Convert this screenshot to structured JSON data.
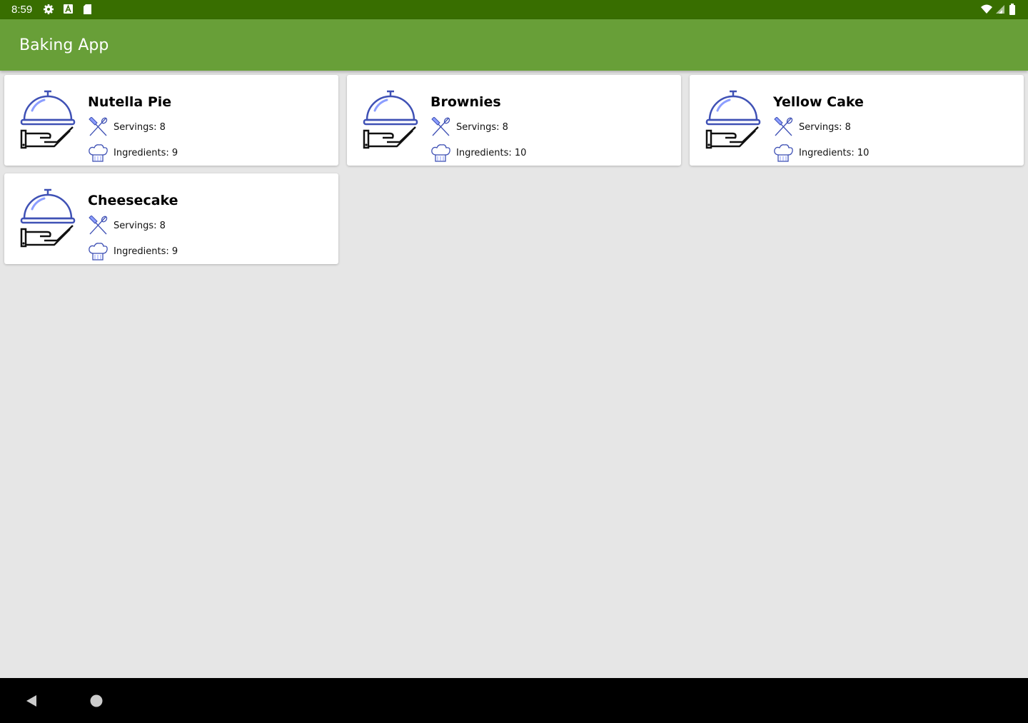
{
  "status_bar": {
    "time": "8:59",
    "left_icons": [
      "gear-icon",
      "a-letter-icon",
      "sd-card-icon"
    ],
    "right_icons": [
      "wifi-icon",
      "signal-icon",
      "battery-icon"
    ],
    "background": "#386e00"
  },
  "app_bar": {
    "title": "Baking App",
    "background": "#689f38"
  },
  "recipes": [
    {
      "name": "Nutella Pie",
      "servings": "Servings: 8",
      "ingredients": "Ingredients: 9"
    },
    {
      "name": "Brownies",
      "servings": "Servings: 8",
      "ingredients": "Ingredients: 10"
    },
    {
      "name": "Yellow Cake",
      "servings": "Servings: 8",
      "ingredients": "Ingredients: 10"
    },
    {
      "name": "Cheesecake",
      "servings": "Servings: 8",
      "ingredients": "Ingredients: 9"
    }
  ],
  "card_icons": {
    "main": "serving-cloche-icon",
    "servings": "fork-spoon-icon",
    "ingredients": "chef-hat-icon"
  },
  "colors": {
    "icon_blue": "#3f51b5",
    "icon_light": "#8c9eff",
    "background": "#e6e6e6"
  },
  "nav_bar": {
    "buttons": [
      "back-icon",
      "home-icon"
    ]
  }
}
